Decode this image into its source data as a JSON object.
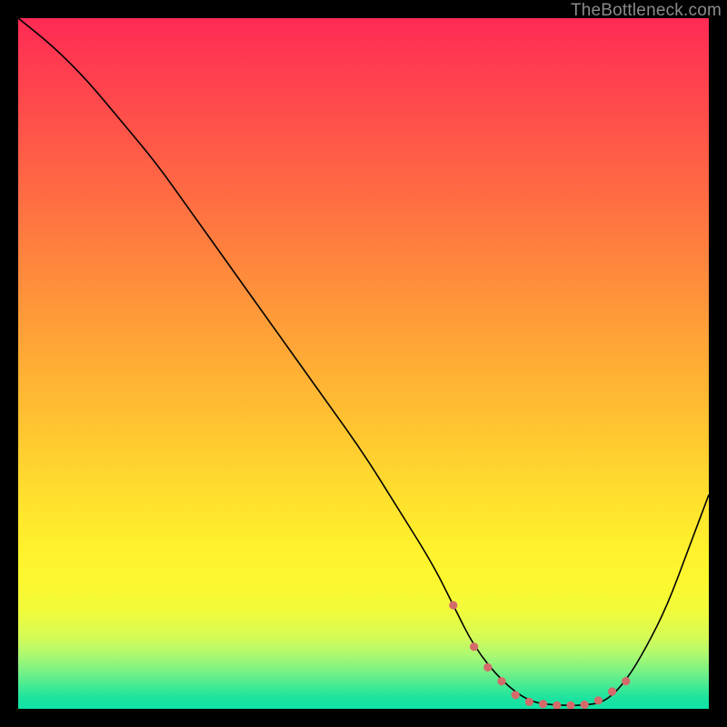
{
  "watermark": {
    "text": "TheBottleneck.com"
  },
  "chart_data": {
    "type": "line",
    "title": "",
    "xlabel": "",
    "ylabel": "",
    "xlim": [
      0,
      100
    ],
    "ylim": [
      0,
      100
    ],
    "grid": false,
    "legend": null,
    "series": [
      {
        "name": "bottleneck-curve",
        "x": [
          0,
          5,
          10,
          15,
          20,
          25,
          30,
          35,
          40,
          45,
          50,
          55,
          60,
          63,
          66,
          70,
          74,
          78,
          82,
          85,
          88,
          91,
          94,
          97,
          100
        ],
        "values": [
          100,
          96,
          91,
          85,
          79,
          72,
          65,
          58,
          51,
          44,
          37,
          29,
          21,
          15,
          9,
          4,
          1,
          0.5,
          0.5,
          1,
          4,
          9,
          15,
          23,
          31
        ]
      }
    ],
    "markers": {
      "name": "highlight-dots",
      "color": "#d46a6a",
      "x": [
        63,
        66,
        68,
        70,
        72,
        74,
        76,
        78,
        80,
        82,
        84,
        86,
        88
      ],
      "values": [
        15,
        9,
        6,
        4,
        2,
        1,
        0.7,
        0.5,
        0.5,
        0.6,
        1.2,
        2.5,
        4
      ]
    },
    "background_gradient": {
      "direction": "top-to-bottom",
      "stops": [
        {
          "pos": 0.0,
          "color": "#ff2a55"
        },
        {
          "pos": 0.5,
          "color": "#ffb030"
        },
        {
          "pos": 0.8,
          "color": "#fff82c"
        },
        {
          "pos": 1.0,
          "color": "#10e1a5"
        }
      ]
    }
  }
}
